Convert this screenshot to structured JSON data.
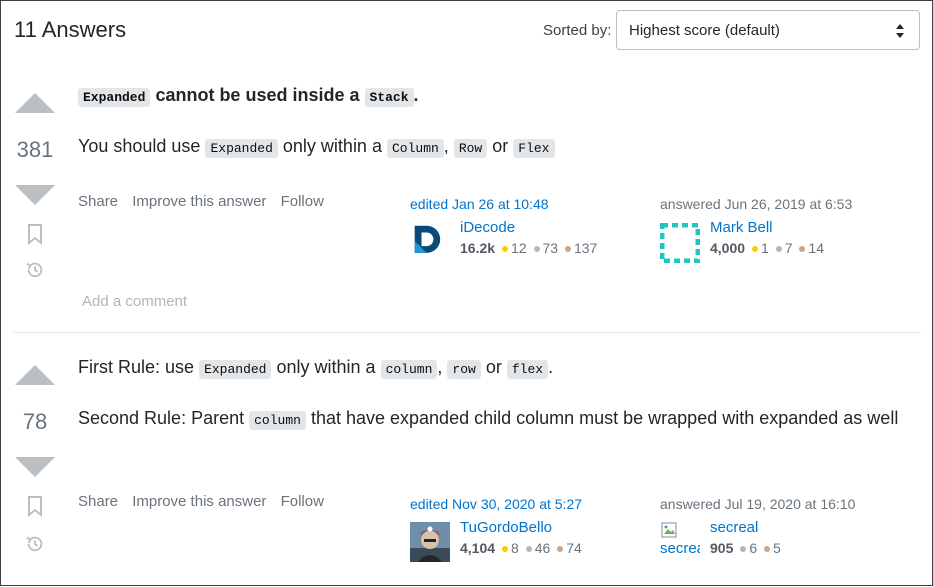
{
  "header": {
    "answers_count": "11 Answers",
    "sorted_label": "Sorted by:",
    "sort_value": "Highest score (default)"
  },
  "colors": {
    "link": "#0074cc",
    "vote_arrow": "#babfc4",
    "code_bg": "#e3e6e8"
  },
  "answers": [
    {
      "score": "381",
      "title_code_1": "Expanded",
      "title_mid": "cannot be used inside a",
      "title_code_2": "Stack",
      "title_end": ".",
      "p1_text_1": "You should use",
      "p1_code_1": "Expanded",
      "p1_text_2": "only within a",
      "p1_code_2": "Column",
      "p1_comma": ",",
      "p1_code_3": "Row",
      "p1_text_3": "or",
      "p1_code_4": "Flex",
      "menu": {
        "share": "Share",
        "improve": "Improve this answer",
        "follow": "Follow"
      },
      "edited": {
        "action": "edited Jan 26 at 10:48",
        "user": "iDecode",
        "rep": "16.2k",
        "gold": "12",
        "silver": "73",
        "bronze": "137",
        "avatar_icon": "idecode-logo-icon"
      },
      "answered": {
        "action": "answered Jun 26, 2019 at 6:53",
        "user": "Mark Bell",
        "rep": "4,000",
        "gold": "1",
        "silver": "7",
        "bronze": "14",
        "avatar_icon": "identicon-icon"
      },
      "add_comment": "Add a comment"
    },
    {
      "score": "78",
      "p1_text_1": "First Rule: use",
      "p1_code_1": "Expanded",
      "p1_text_2": "only within a",
      "p1_code_2": "column",
      "p1_comma": ",",
      "p1_code_3": "row",
      "p1_text_3": "or",
      "p1_code_4": "flex",
      "p1_end": ".",
      "p2_text_1": "Second Rule: Parent",
      "p2_code_1": "column",
      "p2_text_2": "that have expanded child column must be wrapped with expanded as well",
      "menu": {
        "share": "Share",
        "improve": "Improve this answer",
        "follow": "Follow"
      },
      "edited": {
        "action": "edited Nov 30, 2020 at 5:27",
        "user": "TuGordoBello",
        "rep": "4,104",
        "gold": "8",
        "silver": "46",
        "bronze": "74",
        "avatar_icon": "user-photo-icon"
      },
      "answered": {
        "action": "answered Jul 19, 2020 at 16:10",
        "user": "secreal",
        "avatar_alt": "secreal",
        "rep": "905",
        "silver": "6",
        "bronze": "5",
        "avatar_icon": "broken-image-icon"
      }
    }
  ]
}
